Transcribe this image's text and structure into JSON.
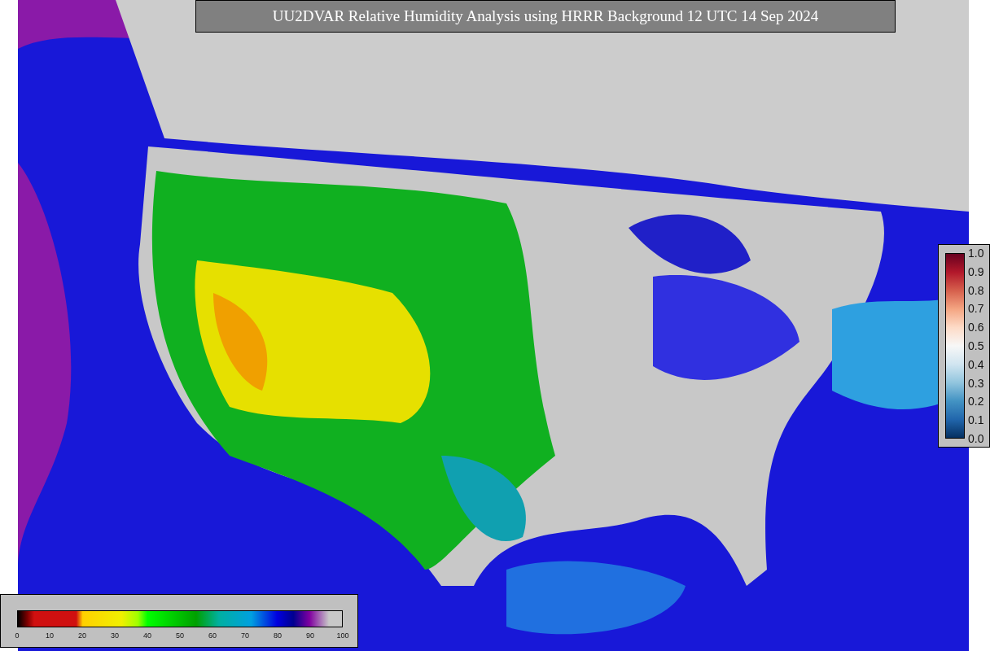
{
  "title": "UU2DVAR Relative Humidity Analysis using HRRR Background 12 UTC 14 Sep 2024",
  "station_colorbar": {
    "ticks": [
      "1.0",
      "0.9",
      "0.8",
      "0.7",
      "0.6",
      "0.5",
      "0.4",
      "0.3",
      "0.2",
      "0.1",
      "0.0"
    ]
  },
  "humidity_colorbar": {
    "ticks": [
      "0",
      "10",
      "20",
      "30",
      "40",
      "50",
      "60",
      "70",
      "80",
      "90",
      "100"
    ]
  }
}
